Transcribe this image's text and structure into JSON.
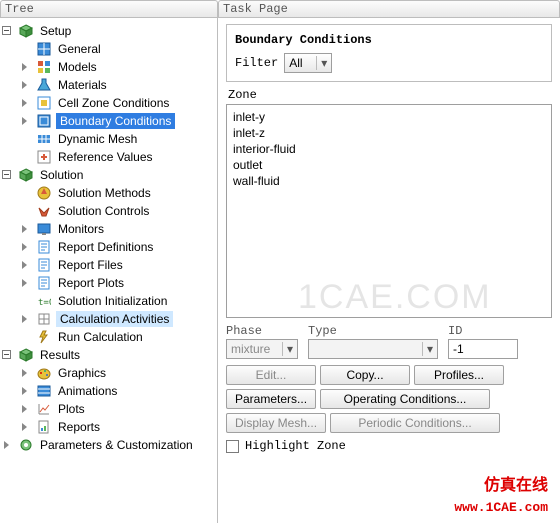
{
  "header": {
    "tree": "Tree",
    "task": "Task Page"
  },
  "tree": {
    "setup": {
      "label": "Setup",
      "general": "General",
      "models": "Models",
      "materials": "Materials",
      "cellzone": "Cell Zone Conditions",
      "boundary": "Boundary Conditions",
      "dynmesh": "Dynamic Mesh",
      "refvals": "Reference Values"
    },
    "solution": {
      "label": "Solution",
      "methods": "Solution Methods",
      "controls": "Solution Controls",
      "monitors": "Monitors",
      "repdef": "Report Definitions",
      "repfiles": "Report Files",
      "replots": "Report Plots",
      "init": "Solution Initialization",
      "calcact": "Calculation Activities",
      "runcalc": "Run Calculation"
    },
    "results": {
      "label": "Results",
      "graphics": "Graphics",
      "anim": "Animations",
      "plots": "Plots",
      "reports": "Reports"
    },
    "params": "Parameters & Customization"
  },
  "task": {
    "title": "Boundary Conditions",
    "filter_label": "Filter",
    "filter_value": "All",
    "zone_label": "Zone",
    "zones": [
      "inlet-y",
      "inlet-z",
      "interior-fluid",
      "outlet",
      "wall-fluid"
    ],
    "phase_label": "Phase",
    "phase_value": "mixture",
    "type_label": "Type",
    "type_value": "",
    "id_label": "ID",
    "id_value": "-1",
    "btn_edit": "Edit...",
    "btn_copy": "Copy...",
    "btn_profiles": "Profiles...",
    "btn_params": "Parameters...",
    "btn_opcond": "Operating Conditions...",
    "btn_dispmesh": "Display Mesh...",
    "btn_periodic": "Periodic Conditions...",
    "highlight": "Highlight Zone"
  },
  "watermark": {
    "bg": "1CAE.COM",
    "cn": "仿真在线",
    "url": "www.1CAE.com"
  }
}
